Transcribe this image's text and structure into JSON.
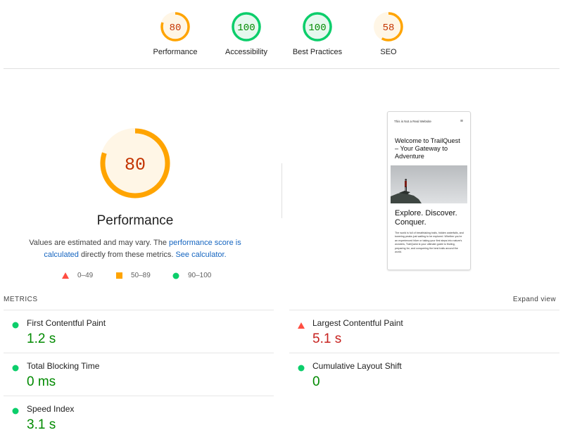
{
  "colors": {
    "pass": "#0cce6b",
    "average": "#ffa400",
    "fail": "#ff4e42",
    "link": "#1565c0",
    "value_good": "#008a00",
    "value_bad": "#c7221f"
  },
  "categories": [
    {
      "score": "80",
      "label": "Performance",
      "level": "average",
      "fraction": 0.8
    },
    {
      "score": "100",
      "label": "Accessibility",
      "level": "pass",
      "fraction": 1.0
    },
    {
      "score": "100",
      "label": "Best Practices",
      "level": "pass",
      "fraction": 1.0
    },
    {
      "score": "58",
      "label": "SEO",
      "level": "average",
      "fraction": 0.58
    }
  ],
  "main": {
    "score": "80",
    "fraction": 0.8,
    "title": "Performance",
    "desc_text_1": "Values are estimated and may vary. The ",
    "desc_link_1": "performance score is calculated",
    "desc_text_2": " directly from these metrics. ",
    "desc_link_2": "See calculator."
  },
  "legend": [
    {
      "range": "0–49",
      "icon": "triangle-icon"
    },
    {
      "range": "50–89",
      "icon": "square-icon"
    },
    {
      "range": "90–100",
      "icon": "circle-icon"
    }
  ],
  "screenshot": {
    "site_title": "This is Not a Real Website",
    "menu_icon": "≡",
    "heading": "Welcome to TrailQuest – Your Gateway to Adventure",
    "subheading": "Explore. Discover. Conquer.",
    "body_text": "The world is full of breathtaking trails, hidden waterfalls, and towering peaks just waiting to be explored. Whether you're an experienced hiker or taking your first steps into nature's wonders, TrailQuest is your ultimate guide to finding, preparing for, and conquering the best trails around the world."
  },
  "metrics_section": {
    "header": "METRICS",
    "expand_label": "Expand view",
    "items": [
      {
        "label": "First Contentful Paint",
        "value": "1.2 s",
        "status": "pass"
      },
      {
        "label": "Largest Contentful Paint",
        "value": "5.1 s",
        "status": "fail"
      },
      {
        "label": "Total Blocking Time",
        "value": "0 ms",
        "status": "pass"
      },
      {
        "label": "Cumulative Layout Shift",
        "value": "0",
        "status": "pass"
      },
      {
        "label": "Speed Index",
        "value": "3.1 s",
        "status": "pass"
      }
    ]
  }
}
